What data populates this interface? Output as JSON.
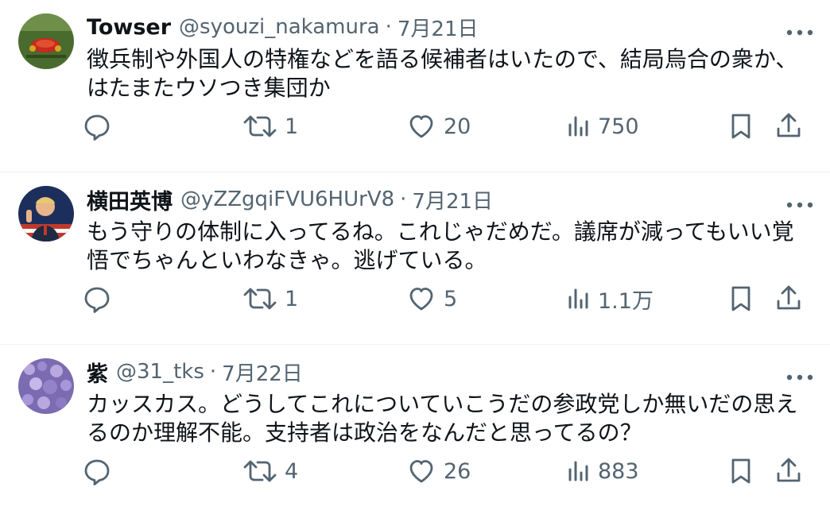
{
  "tweets": [
    {
      "name": "Towser",
      "handle": "@syouzi_nakamura",
      "separator": "·",
      "date": "7月21日",
      "text": "徴兵制や外国人の特権などを語る候補者はいたので、結局烏合の衆か、はたまたウソつき集団か",
      "reposts": "1",
      "likes": "20",
      "views": "750",
      "avatar_colors": {
        "bg": "#4a6b2e",
        "accent": "#c8281e"
      }
    },
    {
      "name": "横田英博",
      "handle": "@yZZgqiFVU6HUrV8",
      "separator": "·",
      "date": "7月21日",
      "text": "もう守りの体制に入ってるね。これじゃだめだ。議席が減ってもいい覚悟でちゃんといわなきゃ。逃げている。",
      "reposts": "1",
      "likes": "5",
      "views": "1.1万",
      "avatar_colors": {
        "bg": "#1c2f5c",
        "accent": "#c0392b"
      }
    },
    {
      "name": "紫",
      "handle": "@31_tks",
      "separator": "·",
      "date": "7月22日",
      "text": "カッスカス。どうしてこれについていこうだの参政党しか無いだの思えるのか理解不能。支持者は政治をなんだと思ってるの？",
      "reposts": "4",
      "likes": "26",
      "views": "883",
      "avatar_colors": {
        "bg": "#7b6bb0",
        "accent": "#b9a8e0"
      }
    }
  ],
  "icons": {
    "reply": "reply-icon",
    "repost": "repost-icon",
    "like": "heart-icon",
    "views": "views-icon",
    "bookmark": "bookmark-icon",
    "share": "share-icon",
    "more": "more-icon"
  },
  "colors": {
    "text": "#0f1419",
    "secondary": "#536471",
    "divider": "#eff3f4"
  }
}
